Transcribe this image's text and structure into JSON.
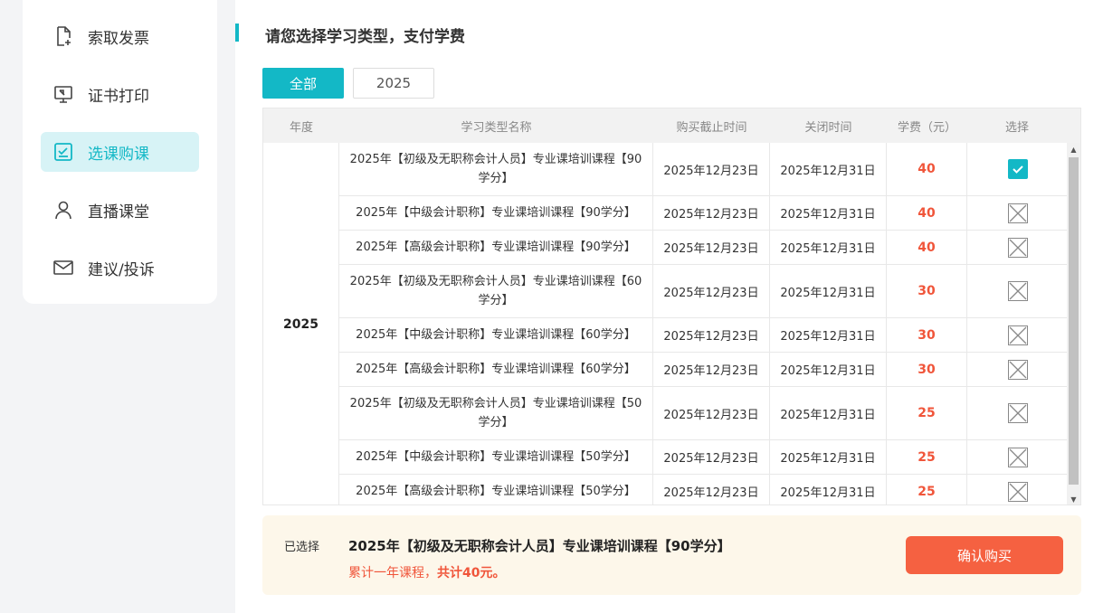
{
  "sidebar": {
    "items": [
      {
        "label": "索取发票",
        "icon": "invoice-icon"
      },
      {
        "label": "证书打印",
        "icon": "monitor-icon"
      },
      {
        "label": "选课购课",
        "icon": "checklist-icon",
        "active": true
      },
      {
        "label": "直播课堂",
        "icon": "user-icon"
      },
      {
        "label": "建议/投诉",
        "icon": "mail-icon"
      }
    ]
  },
  "main": {
    "title": "请您选择学习类型，支付学费",
    "filters": [
      "全部",
      "2025"
    ],
    "columns": [
      "年度",
      "学习类型名称",
      "购买截止时间",
      "关闭时间",
      "学费（元）",
      "选择"
    ],
    "year": "2025",
    "rows": [
      {
        "name": "2025年【初级及无职称会计人员】专业课培训课程【90学分】",
        "deadline": "2025年12月23日",
        "close": "2025年12月31日",
        "fee": "40",
        "selected": true
      },
      {
        "name": "2025年【中级会计职称】专业课培训课程【90学分】",
        "deadline": "2025年12月23日",
        "close": "2025年12月31日",
        "fee": "40",
        "selected": false
      },
      {
        "name": "2025年【高级会计职称】专业课培训课程【90学分】",
        "deadline": "2025年12月23日",
        "close": "2025年12月31日",
        "fee": "40",
        "selected": false
      },
      {
        "name": "2025年【初级及无职称会计人员】专业课培训课程【60学分】",
        "deadline": "2025年12月23日",
        "close": "2025年12月31日",
        "fee": "30",
        "selected": false
      },
      {
        "name": "2025年【中级会计职称】专业课培训课程【60学分】",
        "deadline": "2025年12月23日",
        "close": "2025年12月31日",
        "fee": "30",
        "selected": false
      },
      {
        "name": "2025年【高级会计职称】专业课培训课程【60学分】",
        "deadline": "2025年12月23日",
        "close": "2025年12月31日",
        "fee": "30",
        "selected": false
      },
      {
        "name": "2025年【初级及无职称会计人员】专业课培训课程【50学分】",
        "deadline": "2025年12月23日",
        "close": "2025年12月31日",
        "fee": "25",
        "selected": false
      },
      {
        "name": "2025年【中级会计职称】专业课培训课程【50学分】",
        "deadline": "2025年12月23日",
        "close": "2025年12月31日",
        "fee": "25",
        "selected": false
      },
      {
        "name": "2025年【高级会计职称】专业课培训课程【50学分】",
        "deadline": "2025年12月23日",
        "close": "2025年12月31日",
        "fee": "25",
        "selected": false
      }
    ]
  },
  "summary": {
    "label": "已选择",
    "course": "2025年【初级及无职称会计人员】专业课培训课程【90学分】",
    "note_prefix": "累计一年课程，",
    "note_total": "共计40元。",
    "button": "确认购买"
  },
  "colors": {
    "accent": "#13b8c6",
    "price": "#f0553a",
    "buy_button": "#f56141",
    "summary_bg": "#fdf7ea"
  }
}
